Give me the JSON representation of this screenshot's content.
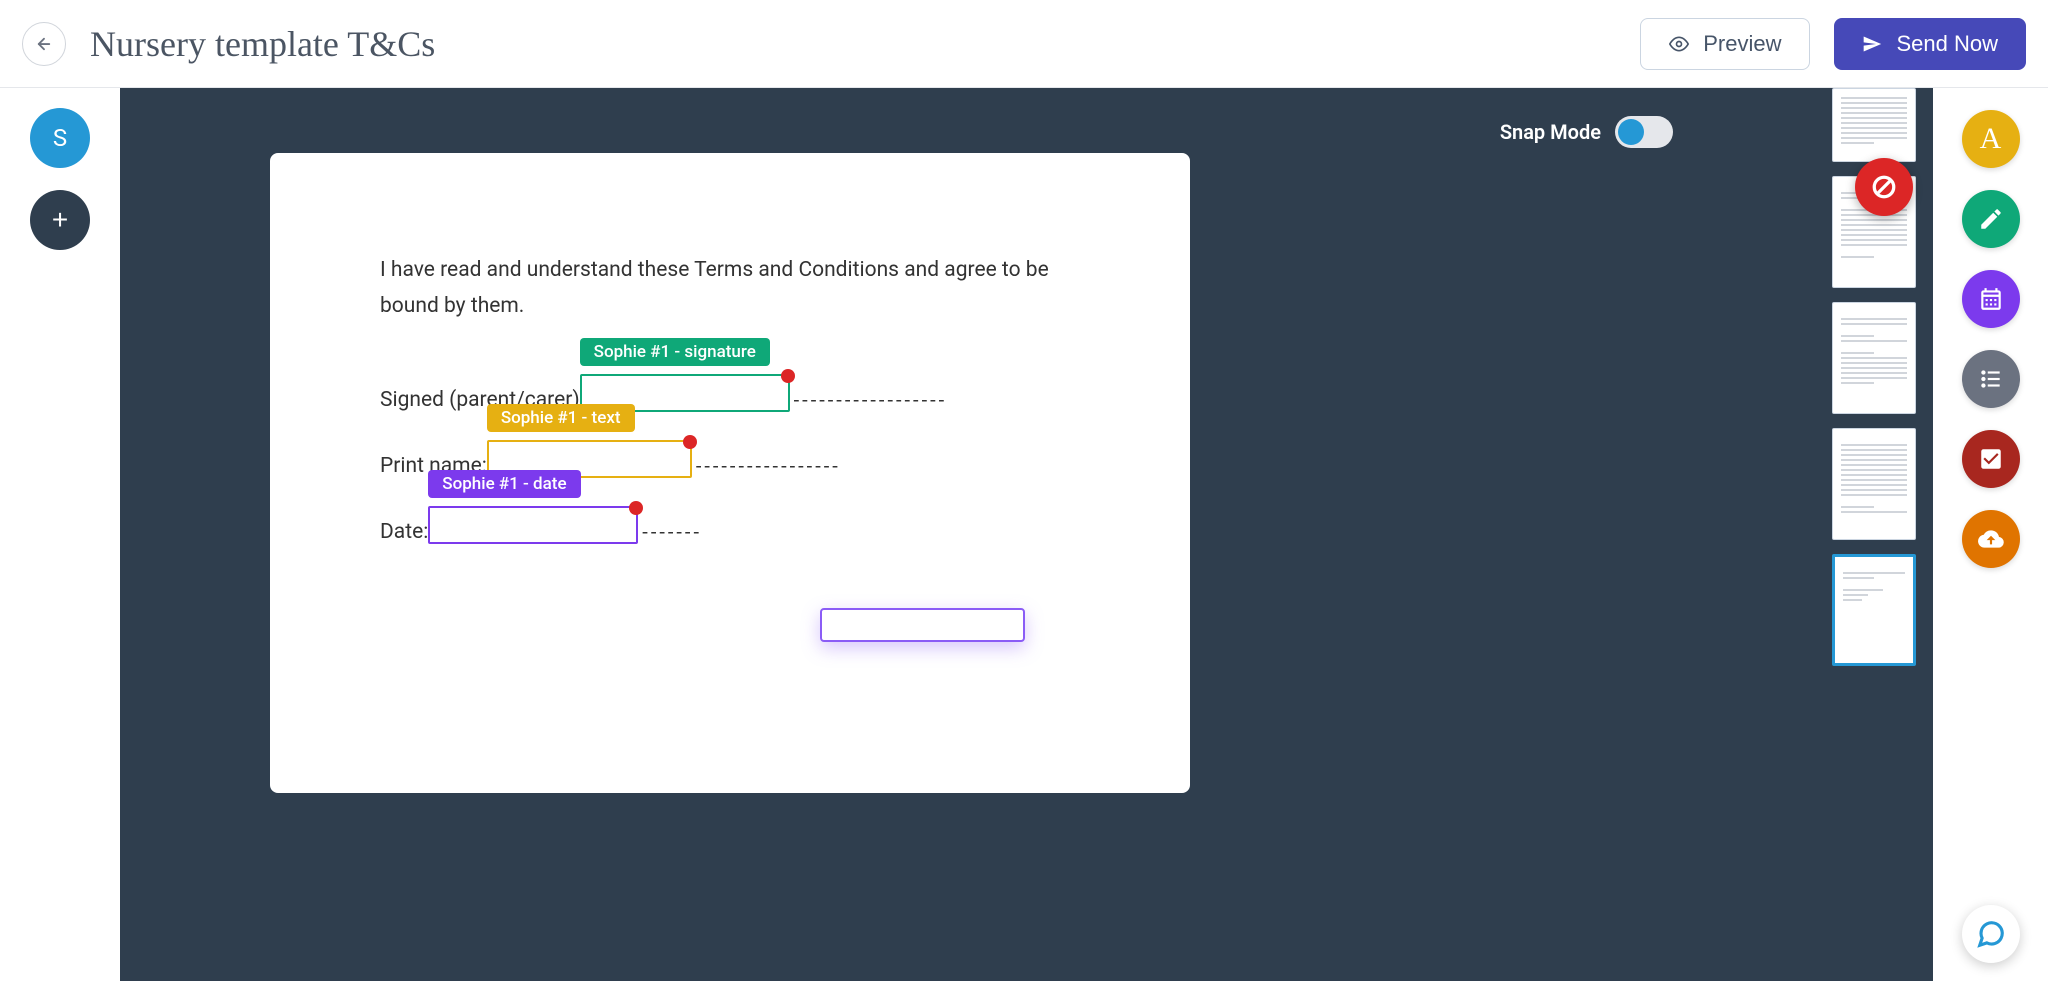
{
  "header": {
    "title": "Nursery template T&Cs",
    "preview": "Preview",
    "send": "Send Now"
  },
  "left": {
    "avatar_initial": "S",
    "add": "+"
  },
  "canvas": {
    "snap_label": "Snap Mode",
    "consent_text": "I have read and understand these Terms and Conditions and agree to be bound by them.",
    "signed_label": "Signed (parent/carer)",
    "print_label": "Print name:",
    "date_label": "Date:",
    "sig_tag": "Sophie #1 - signature",
    "txt_tag": "Sophie #1 - text",
    "date_tag": "Sophie #1 - date"
  },
  "tools": {
    "text_glyph": "A"
  },
  "thumbs": {
    "active_index": 4
  }
}
